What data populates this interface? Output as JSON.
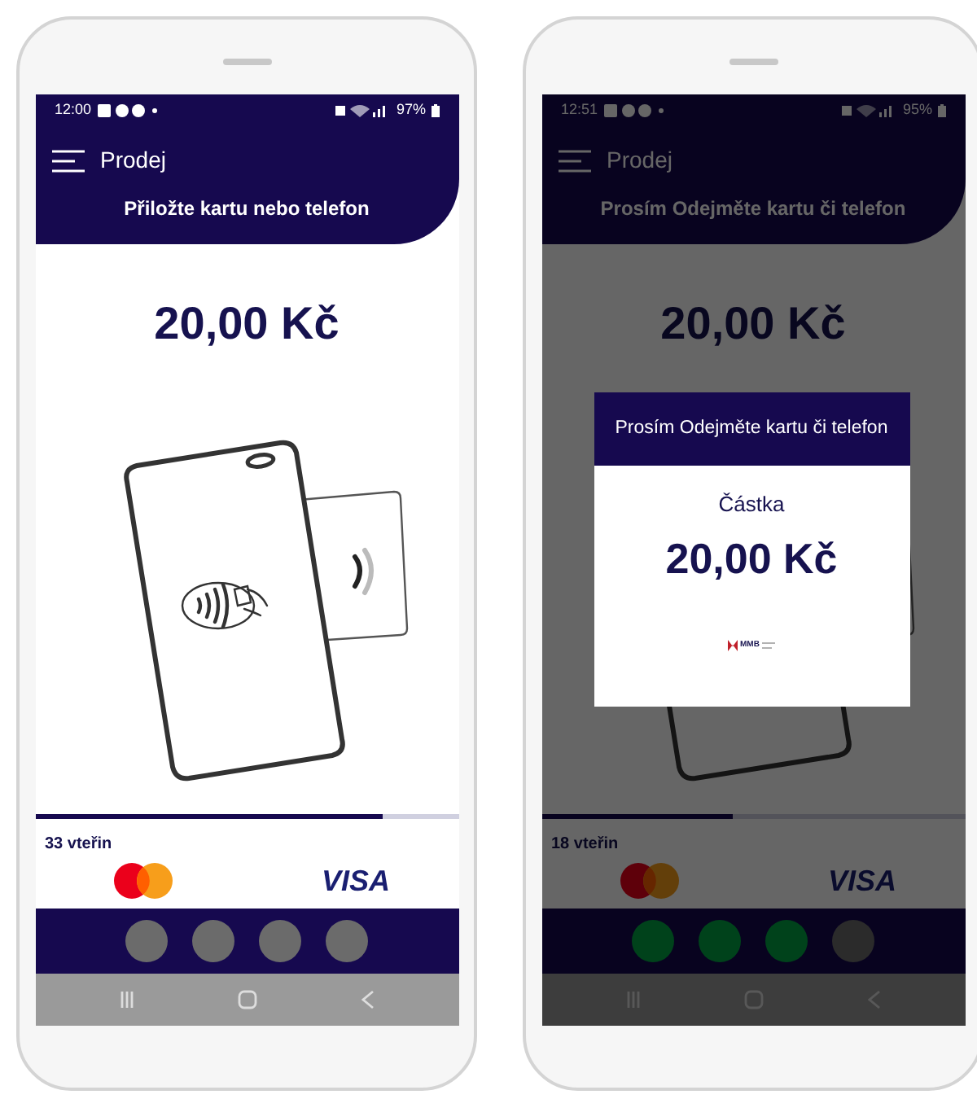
{
  "phones": [
    {
      "dimmed": false,
      "status_bar": {
        "time": "12:00",
        "battery": "97%"
      },
      "header": {
        "menu_title": "Prodej",
        "instruction": "Přiložte kartu nebo telefon"
      },
      "amount": "20,00 Kč",
      "progress": {
        "level": 0.82
      },
      "countdown": "33 vteřin",
      "card_brand": "VISA",
      "indicators": [
        {
          "on": false
        },
        {
          "on": false
        },
        {
          "on": false
        },
        {
          "on": false
        }
      ]
    },
    {
      "dimmed": true,
      "status_bar": {
        "time": "12:51",
        "battery": "95%"
      },
      "header": {
        "menu_title": "Prodej",
        "instruction": "Prosím Odejměte kartu či telefon"
      },
      "amount": "20,00 Kč",
      "progress": {
        "level": 0.45
      },
      "countdown": "18 vteřin",
      "card_brand": "VISA",
      "indicators": [
        {
          "on": true
        },
        {
          "on": true
        },
        {
          "on": true
        },
        {
          "on": false
        }
      ],
      "dialog": {
        "title": "Prosím Odejměte kartu či telefon",
        "label": "Částka",
        "amount": "20,00 Kč",
        "logo_text": "MMB"
      }
    }
  ]
}
